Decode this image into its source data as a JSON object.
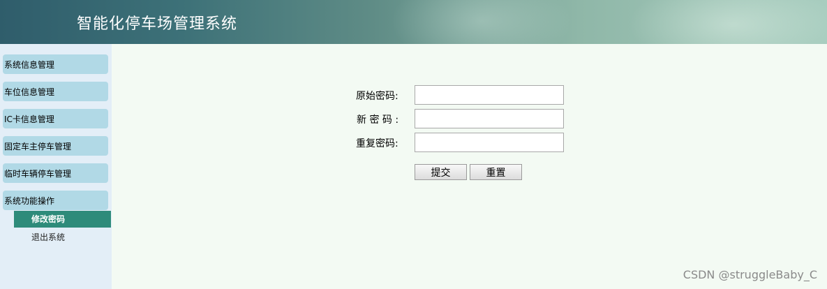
{
  "header": {
    "title": "智能化停车场管理系统"
  },
  "sidebar": {
    "items": [
      {
        "label": "系统信息管理"
      },
      {
        "label": "车位信息管理"
      },
      {
        "label": "IC卡信息管理"
      },
      {
        "label": "固定车主停车管理"
      },
      {
        "label": "临时车辆停车管理"
      },
      {
        "label": "系统功能操作"
      }
    ],
    "subitems": [
      {
        "label": "修改密码",
        "active": true
      },
      {
        "label": "退出系统",
        "active": false
      }
    ]
  },
  "form": {
    "old_password_label": "原始密码:",
    "new_password_label": "新 密 码 :",
    "confirm_password_label": "重复密码:",
    "old_password_value": "",
    "new_password_value": "",
    "confirm_password_value": "",
    "submit_label": "提交",
    "reset_label": "重置"
  },
  "watermark": "CSDN @struggleBaby_C",
  "colors": {
    "menu_bg": "#b1d9e6",
    "active_sub_bg": "#2e8b7a",
    "main_bg": "#f3faf3",
    "sidebar_bg": "#e3eef7"
  }
}
